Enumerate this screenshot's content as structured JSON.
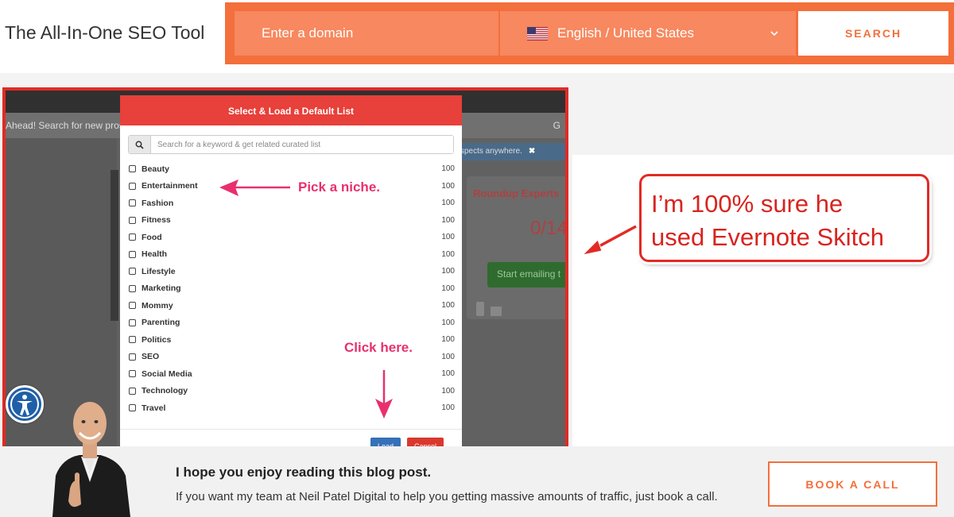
{
  "header": {
    "site_title": "The All-In-One SEO Tool",
    "domain_placeholder": "Enter a domain",
    "language": "English / United States",
    "search_label": "SEARCH"
  },
  "screenshot": {
    "url_bar_text": "Ahead! Search for new prospe",
    "url_bar_right": "G",
    "notice_text": "spects anywhere.",
    "notice_close": "✖",
    "card_title": "Roundup Experts",
    "card_count": "0/14",
    "card_button": "Start emailing t"
  },
  "modal": {
    "title": "Select & Load a Default List",
    "search_placeholder": "Search for a keyword & get related curated list",
    "items": [
      {
        "label": "Beauty",
        "count": "100"
      },
      {
        "label": "Entertainment",
        "count": "100"
      },
      {
        "label": "Fashion",
        "count": "100"
      },
      {
        "label": "Fitness",
        "count": "100"
      },
      {
        "label": "Food",
        "count": "100"
      },
      {
        "label": "Health",
        "count": "100"
      },
      {
        "label": "Lifestyle",
        "count": "100"
      },
      {
        "label": "Marketing",
        "count": "100"
      },
      {
        "label": "Mommy",
        "count": "100"
      },
      {
        "label": "Parenting",
        "count": "100"
      },
      {
        "label": "Politics",
        "count": "100"
      },
      {
        "label": "SEO",
        "count": "100"
      },
      {
        "label": "Social Media",
        "count": "100"
      },
      {
        "label": "Technology",
        "count": "100"
      },
      {
        "label": "Travel",
        "count": "100"
      }
    ],
    "load_label": "Load",
    "cancel_label": "Cancel"
  },
  "annotations": {
    "pick": "Pick a niche.",
    "click": "Click here.",
    "callout_line1": "I’m 100% sure he",
    "callout_line2": "used Evernote Skitch"
  },
  "banner": {
    "title": "I hope you enjoy reading this blog post.",
    "subtitle": "If you want my team at Neil Patel Digital to help you getting massive amounts of traffic, just book a call.",
    "book_label": "BOOK A CALL"
  },
  "colors": {
    "brand_orange": "#f36f3c",
    "annotation_red": "#e12a25",
    "annotation_pink": "#e8306e"
  }
}
